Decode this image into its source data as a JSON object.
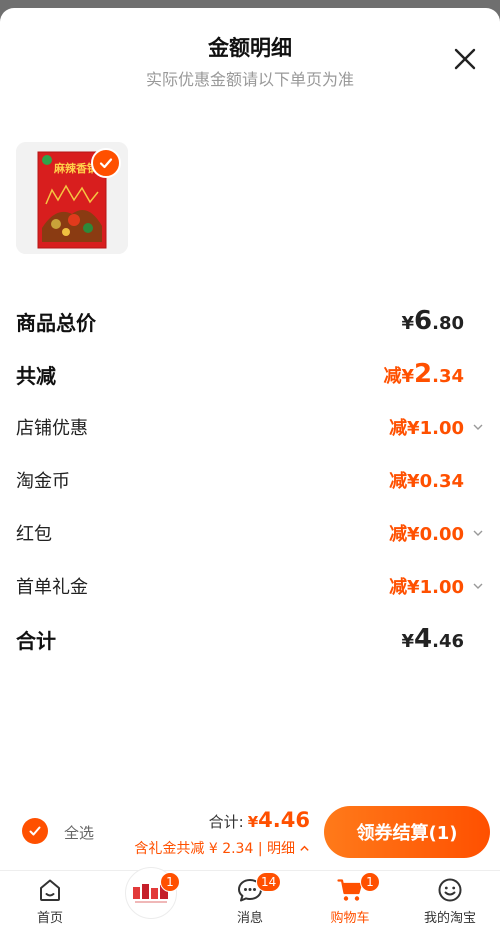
{
  "header": {
    "title": "金额明细",
    "subtitle": "实际优惠金额请以下单页为准"
  },
  "product": {
    "image_text": "麻辣香锅"
  },
  "rows": [
    {
      "label": "商品总价",
      "currency": "¥",
      "int": "6",
      "dec": ".80"
    },
    {
      "label": "共减",
      "prefix": "减¥",
      "int": "2",
      "dec": ".34"
    },
    {
      "label": "店铺优惠",
      "amount": "减¥1.00"
    },
    {
      "label": "淘金币",
      "amount": "减¥0.34"
    },
    {
      "label": "红包",
      "amount": "减¥0.00"
    },
    {
      "label": "首单礼金",
      "amount": "减¥1.00"
    },
    {
      "label": "合计",
      "currency": "¥",
      "int": "4",
      "dec": ".46"
    }
  ],
  "footer": {
    "select_all": "全选",
    "total_label": "合计:",
    "total_currency": "¥",
    "total_value": "4.46",
    "savings": "含礼金共减 ¥ 2.34 | 明细",
    "checkout": "领券结算(1)"
  },
  "tabbar": [
    {
      "label": "首页",
      "icon": "home-icon"
    },
    {
      "label": "",
      "icon": "promo-icon",
      "badge": "1"
    },
    {
      "label": "消息",
      "icon": "message-icon",
      "badge": "14"
    },
    {
      "label": "购物车",
      "icon": "cart-icon",
      "badge": "1"
    },
    {
      "label": "我的淘宝",
      "icon": "profile-icon"
    }
  ],
  "colors": {
    "accent": "#ff5000",
    "text": "#222222",
    "muted": "#999999"
  }
}
